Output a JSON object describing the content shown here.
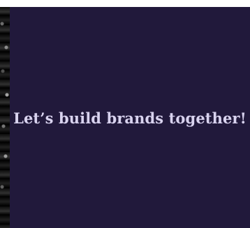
{
  "hero": {
    "tagline": "Let’s build brands together!"
  },
  "colors": {
    "panel_background": "#21193b",
    "tagline_text": "#d9d3ef"
  }
}
